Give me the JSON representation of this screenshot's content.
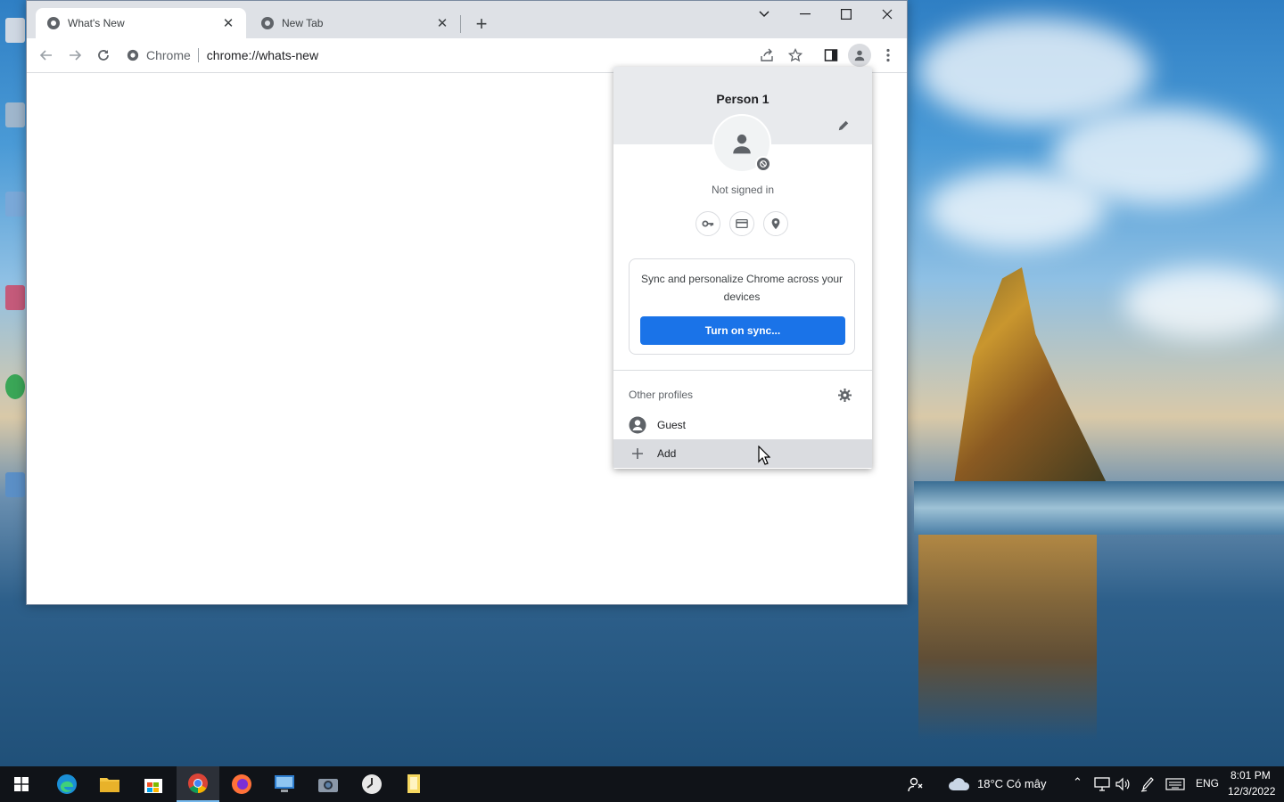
{
  "browser": {
    "tabs": [
      {
        "title": "What's New",
        "active": true
      },
      {
        "title": "New Tab",
        "active": false
      }
    ],
    "omnibox": {
      "chip": "Chrome",
      "url": "chrome://whats-new"
    }
  },
  "profile_menu": {
    "name": "Person 1",
    "status": "Not signed in",
    "sync_text": "Sync and personalize Chrome across your devices",
    "sync_button": "Turn on sync...",
    "other_profiles_label": "Other profiles",
    "guest_label": "Guest",
    "add_label": "Add"
  },
  "taskbar": {
    "weather": "18°C  Có mây",
    "language": "ENG",
    "time": "8:01 PM",
    "date": "12/3/2022"
  },
  "colors": {
    "accent": "#1a73e8",
    "taskbar": "#101318"
  }
}
